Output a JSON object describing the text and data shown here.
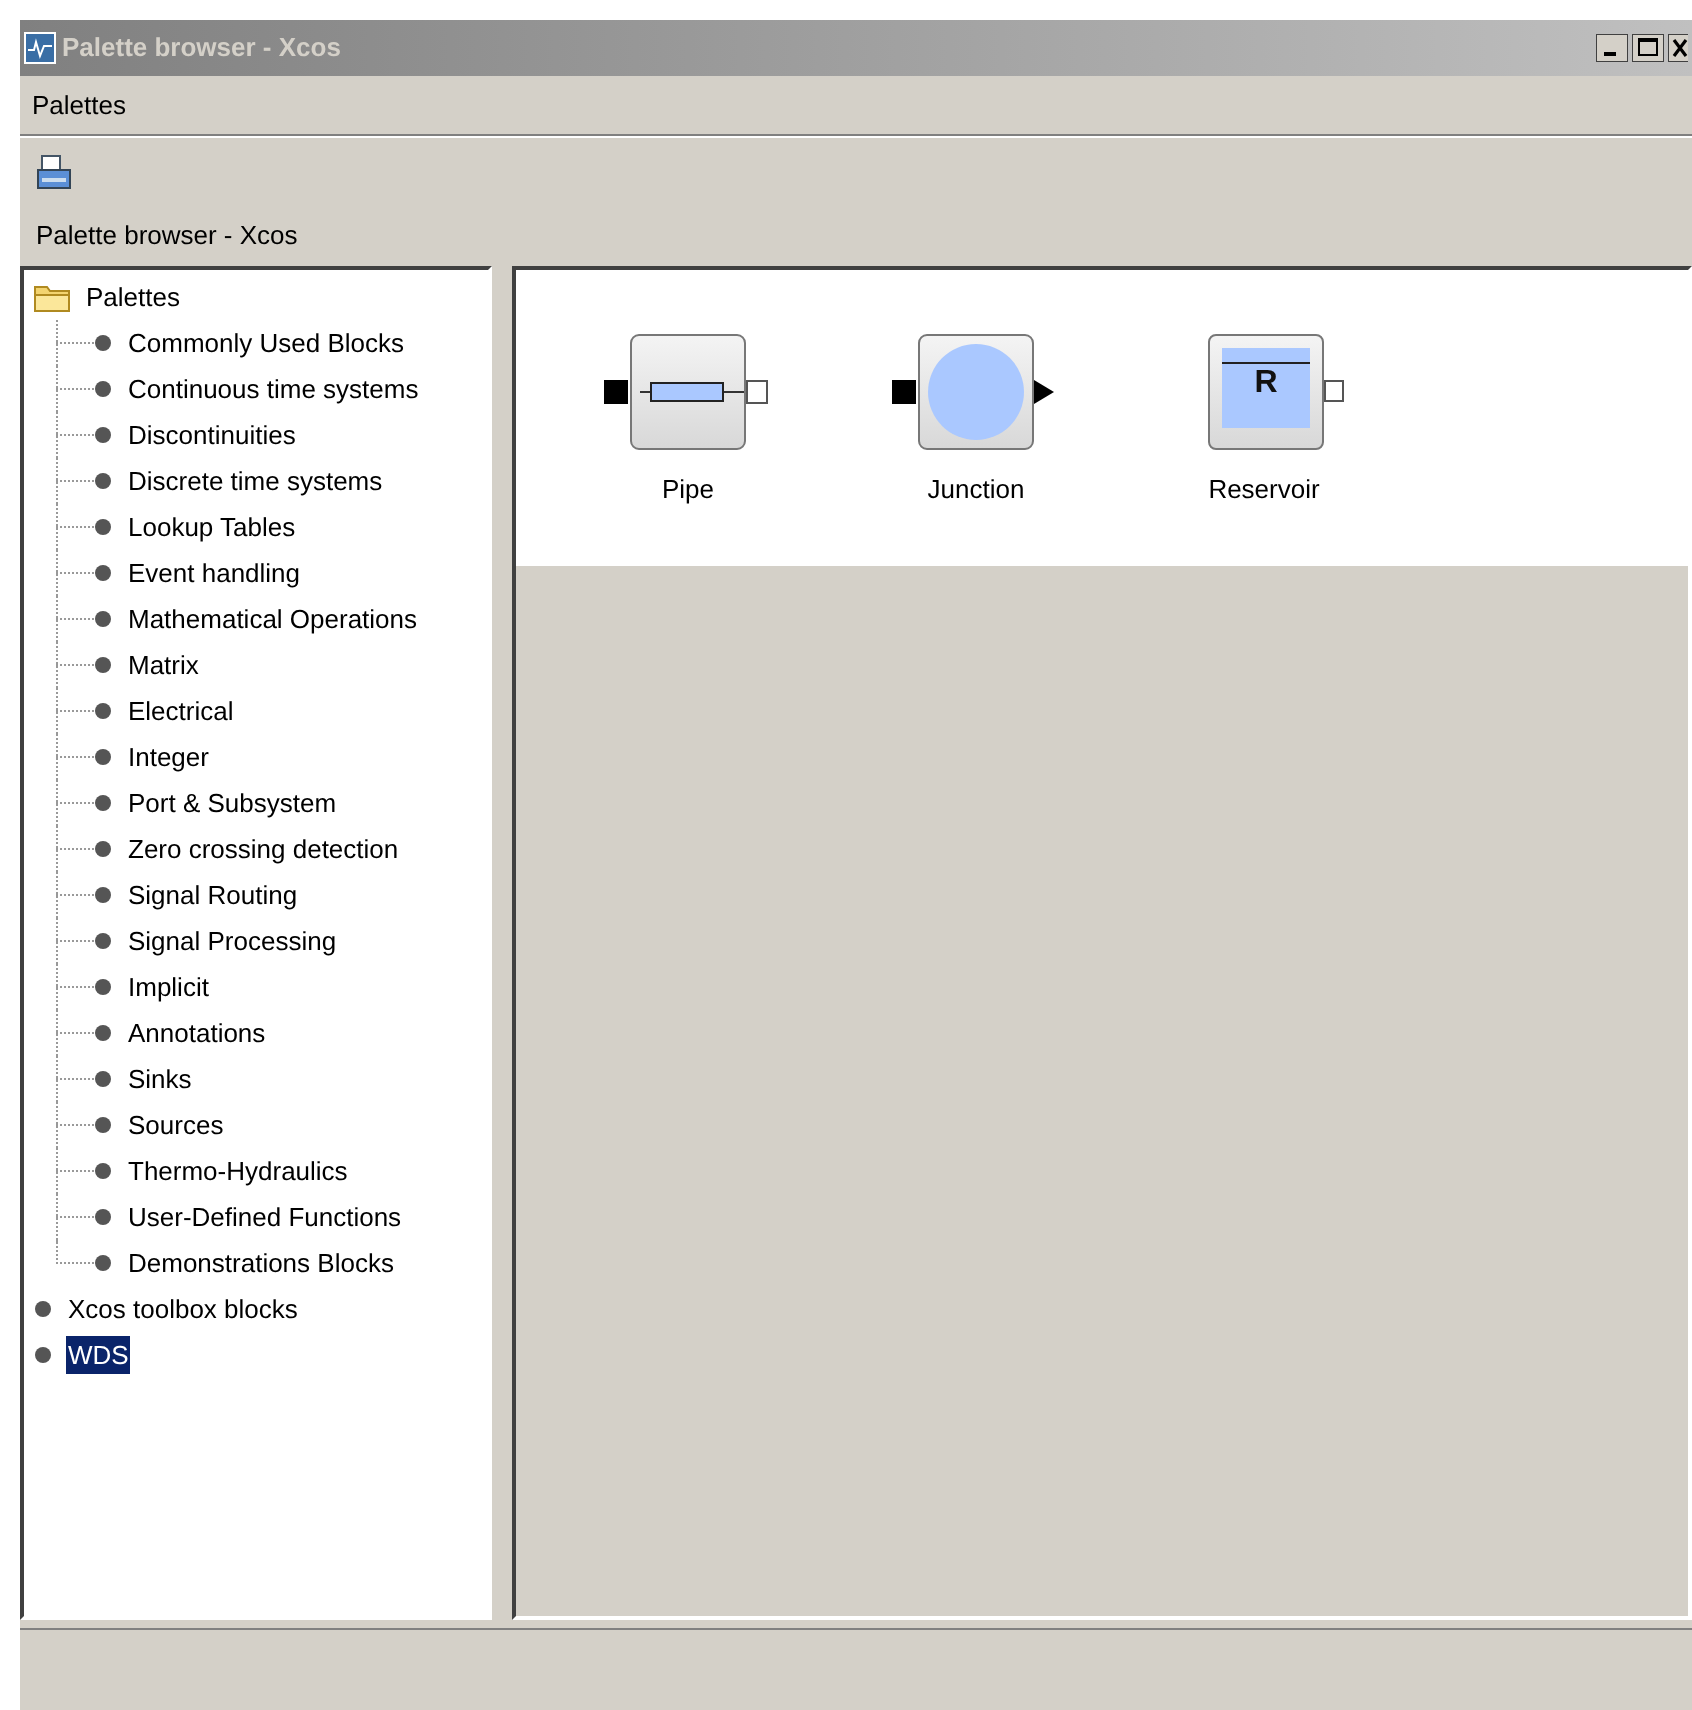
{
  "window": {
    "title": "Palette browser - Xcos"
  },
  "menu": [
    "Palettes"
  ],
  "panel_label": "Palette browser - Xcos",
  "tree": [
    {
      "label": "Palettes",
      "kind": "folder",
      "selected": false,
      "children": [
        {
          "label": "Commonly Used Blocks",
          "selected": false
        },
        {
          "label": "Continuous time systems",
          "selected": false
        },
        {
          "label": "Discontinuities",
          "selected": false
        },
        {
          "label": "Discrete time systems",
          "selected": false
        },
        {
          "label": "Lookup Tables",
          "selected": false
        },
        {
          "label": "Event handling",
          "selected": false
        },
        {
          "label": "Mathematical Operations",
          "selected": false
        },
        {
          "label": "Matrix",
          "selected": false
        },
        {
          "label": "Electrical",
          "selected": false
        },
        {
          "label": "Integer",
          "selected": false
        },
        {
          "label": "Port & Subsystem",
          "selected": false
        },
        {
          "label": "Zero crossing detection",
          "selected": false
        },
        {
          "label": "Signal Routing",
          "selected": false
        },
        {
          "label": "Signal Processing",
          "selected": false
        },
        {
          "label": "Implicit",
          "selected": false
        },
        {
          "label": "Annotations",
          "selected": false
        },
        {
          "label": "Sinks",
          "selected": false
        },
        {
          "label": "Sources",
          "selected": false
        },
        {
          "label": "Thermo-Hydraulics",
          "selected": false
        },
        {
          "label": "User-Defined Functions",
          "selected": false
        },
        {
          "label": "Demonstrations Blocks",
          "selected": false
        }
      ]
    },
    {
      "label": "Xcos toolbox blocks",
      "kind": "leaf",
      "selected": false
    },
    {
      "label": "WDS",
      "kind": "leaf",
      "selected": true
    }
  ],
  "blocks": [
    {
      "label": "Pipe",
      "kind": "pipe"
    },
    {
      "label": "Junction",
      "kind": "junction"
    },
    {
      "label": "Reservoir",
      "kind": "reservoir",
      "glyph": "R"
    }
  ]
}
